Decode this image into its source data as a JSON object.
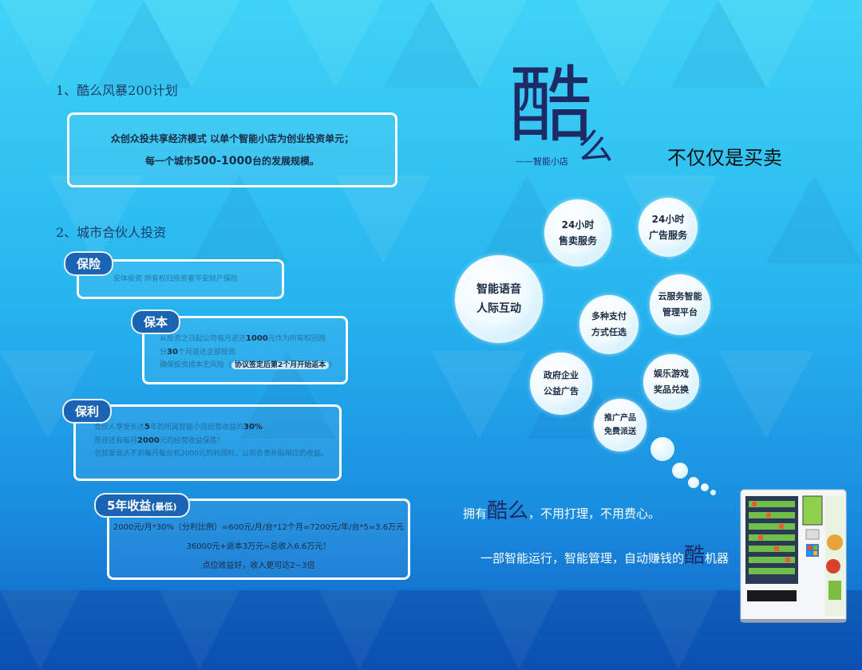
{
  "section1": {
    "title": "1、酷么风暴200计划",
    "line1": "众创众投共享经济模式   以单个智能小店为创业投资单元；",
    "line2_pre": "每一个城市",
    "line2_bold": "500-1000",
    "line2_post": "台的发展规模。"
  },
  "section2": {
    "title": "2、城市合伙人投资",
    "baoxian": {
      "label": "保险",
      "text": "安体投资 所有权归投资者平安财产保险"
    },
    "baoben": {
      "label": "保本",
      "l1_pre": "从投资之日起公司每月返还",
      "l1_bold": "1000",
      "l1_post": "元作为所有权回购",
      "l2_pre": "分",
      "l2_bold": "30",
      "l2_post": "个月返还全部投资",
      "l3_pre": "确保投资成本无风险（",
      "l3_tag": "协议签定后第2个月开始返本",
      "l3_post": "）"
    },
    "baoli": {
      "label": "保利",
      "l1_pre": "合伙人享受长达",
      "l1_b1": "5",
      "l1_mid": "年的所属智能小店经营收益的",
      "l1_b2": "30%",
      "l2_pre": "而且还有每月",
      "l2_bold": "2000",
      "l2_post": "元的经营收益保底！",
      "l3": "也就是说达不到每月每台机2000元的利润时，公司负责补贴相应的收益。"
    },
    "income": {
      "label": "5年收益",
      "label_small": "(最低)",
      "line1": "2000元/月*30%（分利比例）=600元/月/台*12个月=7200元/年/台*5=3.6万元",
      "line2": "36000元+返本3万元=总收入6.6万元！",
      "line3": "点位效益好，收入更可达2~3倍"
    }
  },
  "brand": {
    "char1": "酷",
    "char2": "么",
    "subtitle": "——智能小店",
    "tagline": "不仅仅是买卖"
  },
  "bubbles": [
    {
      "text": "24小时\n售卖服务"
    },
    {
      "text": "24小时\n广告服务"
    },
    {
      "text": "智能语音\n人际互动"
    },
    {
      "text": "多种支付\n方式任选"
    },
    {
      "text": "云服务智能\n管理平台"
    },
    {
      "text": "政府企业\n公益广告"
    },
    {
      "text": "娱乐游戏\n奖品兑换"
    },
    {
      "text": "推广产品\n免费派送"
    }
  ],
  "slogan1": {
    "pre": "拥有",
    "em": "酷么",
    "post": "，不用打理，不用费心。"
  },
  "slogan2": {
    "pre": "一部智能运行，智能管理，自动赚钱的",
    "em": "酷",
    "post": "机器"
  },
  "colors": {
    "accent": "#1b63b3",
    "brand_dark": "#1e2a66",
    "bg_top": "#3fd4f6",
    "bg_bottom": "#0f5fc4"
  }
}
